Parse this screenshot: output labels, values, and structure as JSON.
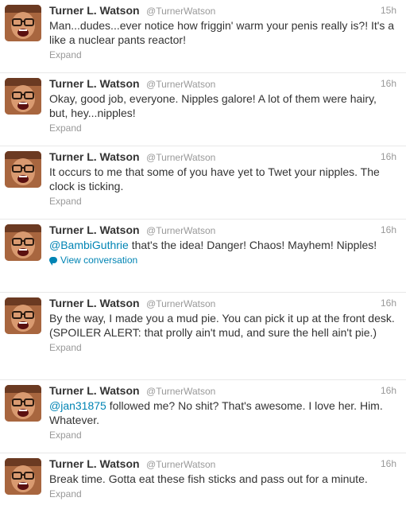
{
  "accent_color": "#0084b4",
  "muted_color": "#999999",
  "tweets": [
    {
      "name": "Turner L. Watson",
      "handle": "@TurnerWatson",
      "time": "15h",
      "text": "Man...dudes...ever notice how friggin' warm your penis really is?! It's a like a nuclear pants reactor!",
      "action": "Expand"
    },
    {
      "name": "Turner L. Watson",
      "handle": "@TurnerWatson",
      "time": "16h",
      "text": "Okay, good job, everyone. Nipples galore! A lot of them were hairy, but, hey...nipples!",
      "action": "Expand"
    },
    {
      "name": "Turner L. Watson",
      "handle": "@TurnerWatson",
      "time": "16h",
      "text": "It occurs to me that some of you have yet to Twet your nipples. The clock is ticking.",
      "action": "Expand"
    },
    {
      "name": "Turner L. Watson",
      "handle": "@TurnerWatson",
      "time": "16h",
      "mention": "@BambiGuthrie",
      "text": " that's the idea! Danger! Chaos! Mayhem! Nipples!",
      "action": "View conversation"
    },
    {
      "name": "Turner L. Watson",
      "handle": "@TurnerWatson",
      "time": "16h",
      "text": "By the way, I made you a mud pie. You can pick it up at the front desk. (SPOILER ALERT: that prolly ain't mud, and sure the hell ain't pie.)",
      "action": "Expand"
    },
    {
      "name": "Turner L. Watson",
      "handle": "@TurnerWatson",
      "time": "16h",
      "mention": "@jan31875",
      "text": " followed me? No shit? That's awesome. I love her. Him. Whatever.",
      "action": "Expand"
    },
    {
      "name": "Turner L. Watson",
      "handle": "@TurnerWatson",
      "time": "16h",
      "text": "Break time. Gotta eat these fish sticks and pass out for a minute.",
      "action": "Expand"
    }
  ]
}
